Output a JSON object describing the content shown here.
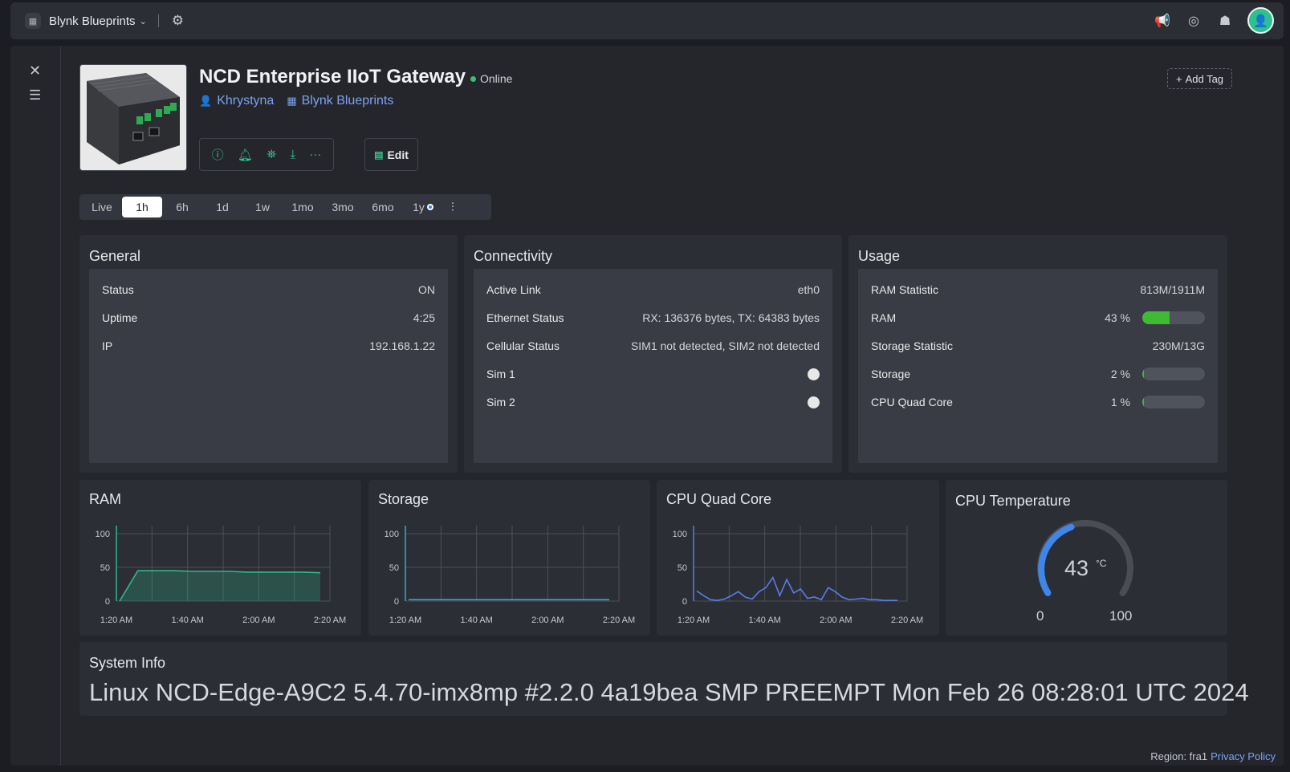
{
  "topbar": {
    "org_name": "Blynk Blueprints",
    "icons": [
      "megaphone-icon",
      "help-icon",
      "bug-icon",
      "user-avatar"
    ]
  },
  "device": {
    "title": "NCD Enterprise IIoT Gateway",
    "status": "Online",
    "owner": "Khrystyna",
    "organization": "Blynk Blueprints",
    "add_tag": "Add Tag",
    "edit_label": "Edit"
  },
  "time_ranges": [
    "Live",
    "1h",
    "6h",
    "1d",
    "1w",
    "1mo",
    "3mo",
    "6mo",
    "1y"
  ],
  "active_range": "1h",
  "general": {
    "title": "General",
    "rows": [
      {
        "label": "Status",
        "value": "ON"
      },
      {
        "label": "Uptime",
        "value": "4:25"
      },
      {
        "label": "IP",
        "value": "192.168.1.22"
      }
    ]
  },
  "connectivity": {
    "title": "Connectivity",
    "rows": [
      {
        "label": "Active Link",
        "value": "eth0"
      },
      {
        "label": "Ethernet Status",
        "value": "RX: 136376 bytes, TX: 64383 bytes"
      },
      {
        "label": "Cellular Status",
        "value": "SIM1 not detected, SIM2 not detected"
      }
    ],
    "toggles": [
      {
        "label": "Sim 1"
      },
      {
        "label": "Sim 2"
      }
    ]
  },
  "usage": {
    "title": "Usage",
    "ram_statistic_label": "RAM Statistic",
    "ram_statistic_value": "813M/1911M",
    "ram_label": "RAM",
    "ram_pct_text": "43 %",
    "ram_pct": 43,
    "storage_statistic_label": "Storage Statistic",
    "storage_statistic_value": "230M/13G",
    "storage_label": "Storage",
    "storage_pct_text": "2 %",
    "storage_pct": 2,
    "cpu_label": "CPU Quad Core",
    "cpu_pct_text": "1 %",
    "cpu_pct": 1
  },
  "charts": {
    "ram_title": "RAM",
    "storage_title": "Storage",
    "cpu_title": "CPU Quad Core",
    "temp_title": "CPU Temperature",
    "temp_value": "43",
    "temp_unit": "°C",
    "temp_min": "0",
    "temp_max": "100"
  },
  "chart_data": [
    {
      "type": "area",
      "title": "RAM",
      "x_ticks": [
        "1:20 AM",
        "1:40 AM",
        "2:00 AM",
        "2:20 AM"
      ],
      "y_ticks": [
        0,
        50,
        100
      ],
      "ylim": [
        0,
        100
      ],
      "color": "#2fb88a",
      "x": [
        0,
        1,
        2,
        3,
        4,
        5,
        6,
        7,
        8,
        9,
        10,
        11
      ],
      "values": [
        0,
        45,
        45,
        45,
        44,
        44,
        44,
        43,
        43,
        43,
        43,
        42
      ]
    },
    {
      "type": "line",
      "title": "Storage",
      "x_ticks": [
        "1:20 AM",
        "1:40 AM",
        "2:00 AM",
        "2:20 AM"
      ],
      "y_ticks": [
        0,
        50,
        100
      ],
      "ylim": [
        0,
        100
      ],
      "color": "#36a8d8",
      "x": [
        0,
        1,
        2,
        3,
        4,
        5,
        6,
        7,
        8,
        9,
        10,
        11
      ],
      "values": [
        2,
        2,
        2,
        2,
        2,
        2,
        2,
        2,
        2,
        2,
        2,
        2
      ]
    },
    {
      "type": "line",
      "title": "CPU Quad Core",
      "x_ticks": [
        "1:20 AM",
        "1:40 AM",
        "2:00 AM",
        "2:20 AM"
      ],
      "y_ticks": [
        0,
        50,
        100
      ],
      "ylim": [
        0,
        100
      ],
      "color": "#5b7de6",
      "x": [
        0,
        1,
        2,
        3,
        4,
        5,
        6,
        7,
        8,
        9,
        10,
        11,
        12,
        13,
        14,
        15,
        16,
        17,
        18,
        19,
        20,
        21,
        22,
        23,
        24,
        25,
        26,
        27,
        28,
        29
      ],
      "values": [
        15,
        8,
        2,
        1,
        3,
        8,
        14,
        6,
        3,
        14,
        20,
        35,
        8,
        32,
        12,
        18,
        4,
        6,
        2,
        20,
        14,
        6,
        2,
        3,
        4,
        2,
        2,
        1,
        1,
        1
      ]
    }
  ],
  "system_info": {
    "title": "System Info",
    "kernel": "Linux NCD-Edge-A9C2 5.4.70-imx8mp #2.2.0 4a19bea SMP PREEMPT Mon Feb 26 08:28:01 UTC 2024"
  },
  "footer": {
    "region": "Region: fra1",
    "privacy": "Privacy Policy"
  }
}
